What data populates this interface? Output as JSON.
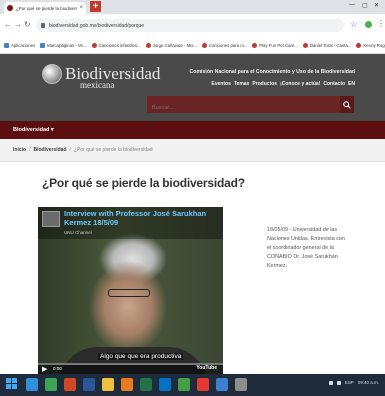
{
  "browser": {
    "tab_title": "¿Por qué se pierde la biodiversi",
    "tab_close": "×",
    "new_tab": "+",
    "url": "biodiversidad.gob.mx/biodiversidad/porque",
    "bookmarks": [
      {
        "label": "Aplicaciones",
        "icon": "apps-grid-icon"
      },
      {
        "label": "Marcapáginas - Ve...",
        "icon": "bookmark-icon"
      },
      {
        "label": "Canciones infantiles...",
        "icon": "video-icon"
      },
      {
        "label": "Jorge Cañavate - Mis...",
        "icon": "video-icon"
      },
      {
        "label": "Canciones para ni...",
        "icon": "video-icon"
      },
      {
        "label": "Play Fun Pet Care...",
        "icon": "video-icon"
      },
      {
        "label": "Daniel Toral - Canta...",
        "icon": "video-icon"
      },
      {
        "label": "Kenny Rogers - Isl...",
        "icon": "video-icon"
      }
    ]
  },
  "header": {
    "logo_main": "Biodiversidad",
    "logo_sub": "mexicana",
    "commission": "Comisión Nacional para el Conocimiento y Uso de la Biodiversidad",
    "nav": [
      "Eventos",
      "Temas",
      "Productos",
      "¡Conoce y actúa!",
      "Contacto",
      "EN"
    ],
    "search_placeholder": "Buscar..."
  },
  "menubar": {
    "label": "Biodiversidad ▾"
  },
  "breadcrumb": {
    "home": "Inicio",
    "section": "Biodiversidad",
    "current": "¿Por qué se pierde la biodiversidad",
    "separator": "/"
  },
  "main": {
    "title": "¿Por qué se pierde la biodiversidad?",
    "video": {
      "title": "Interview with Professor José Sarukhan Kermez 18/5/09",
      "channel": "UNU Channel",
      "caption": "Algo que que era productiva",
      "timecode": "0:00",
      "brand": "YouTube",
      "progress": 0.0
    },
    "description": "18/05/09 - Universidad de las Naciones Unidas. Entrevista con el coordinador general de la CONABIO Dr. José Sarukhán Kermez."
  },
  "taskbar": {
    "icons": [
      {
        "name": "ie-icon",
        "color": "#2f8fd8"
      },
      {
        "name": "store-icon",
        "color": "#3aa655"
      },
      {
        "name": "powerpoint-icon",
        "color": "#d24726"
      },
      {
        "name": "word-icon",
        "color": "#2b579a"
      },
      {
        "name": "explorer-icon",
        "color": "#f0c040"
      },
      {
        "name": "media-icon",
        "color": "#e97a1e"
      },
      {
        "name": "excel-icon",
        "color": "#217346"
      },
      {
        "name": "outlook-icon",
        "color": "#0072c6"
      },
      {
        "name": "app-icon",
        "color": "#43a047"
      },
      {
        "name": "chrome-icon",
        "color": "#e53935"
      },
      {
        "name": "people-icon",
        "color": "#3f7fd0"
      },
      {
        "name": "paint-icon",
        "color": "#8e8e8e"
      }
    ],
    "tray_lang": "ESP",
    "tray_time": "09:40 a.m."
  },
  "colors": {
    "header_bg": "#4a4a4a",
    "menubar_bg": "#5d0f10",
    "search_bg": "#6b2323",
    "taskbar_bg": "#1f2b3a"
  }
}
